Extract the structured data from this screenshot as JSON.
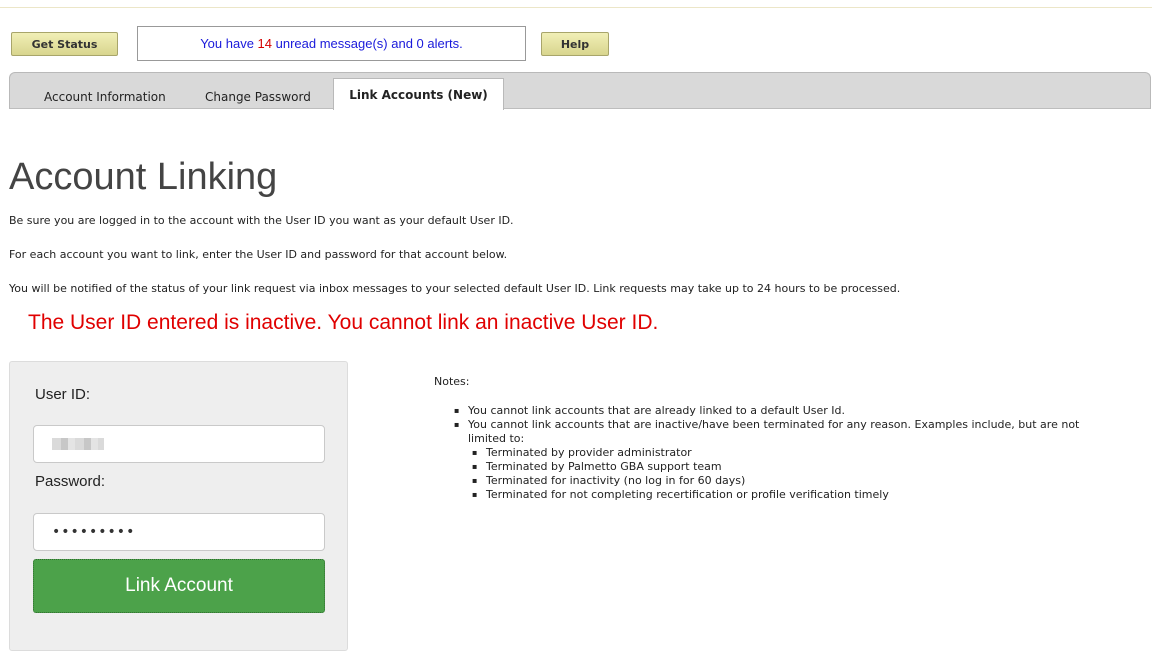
{
  "toolbar": {
    "get_status_label": "Get Status",
    "help_label": "Help",
    "message_prefix": "You have ",
    "message_count": "14",
    "message_suffix": " unread message(s) and 0 alerts."
  },
  "tabs": [
    {
      "label": "Account Information"
    },
    {
      "label": "Change Password"
    },
    {
      "label": "Link Accounts (New)",
      "active": true
    }
  ],
  "page": {
    "title": "Account Linking",
    "paragraphs": [
      "Be sure you are logged in to the account with the User ID you want as your default User ID.",
      "For each account you want to link, enter the User ID and password for that account below.",
      "You will be notified of the status of your link request via inbox messages to your selected default User ID. Link requests may take up to 24 hours to be processed."
    ],
    "error": "The User ID entered is inactive. You cannot link an inactive User ID."
  },
  "form": {
    "user_id_label": "User ID:",
    "password_label": "Password:",
    "password_value": "•••••••••",
    "submit_label": "Link Account"
  },
  "notes": {
    "title": "Notes:",
    "items": [
      "You cannot link accounts that are already linked to a default User Id.",
      "You cannot link accounts that are inactive/have been terminated for any reason. Examples include, but are not limited to:"
    ],
    "subitems": [
      "Terminated by provider administrator",
      "Terminated by Palmetto GBA support team",
      "Terminated for inactivity (no log in for 60 days)",
      "Terminated for not completing recertification or profile verification timely"
    ]
  },
  "colors": {
    "accent_green": "#4ca24a",
    "error_red": "#e00000",
    "message_blue": "#1a1adb",
    "button_yellow": "#e6e3a3"
  }
}
